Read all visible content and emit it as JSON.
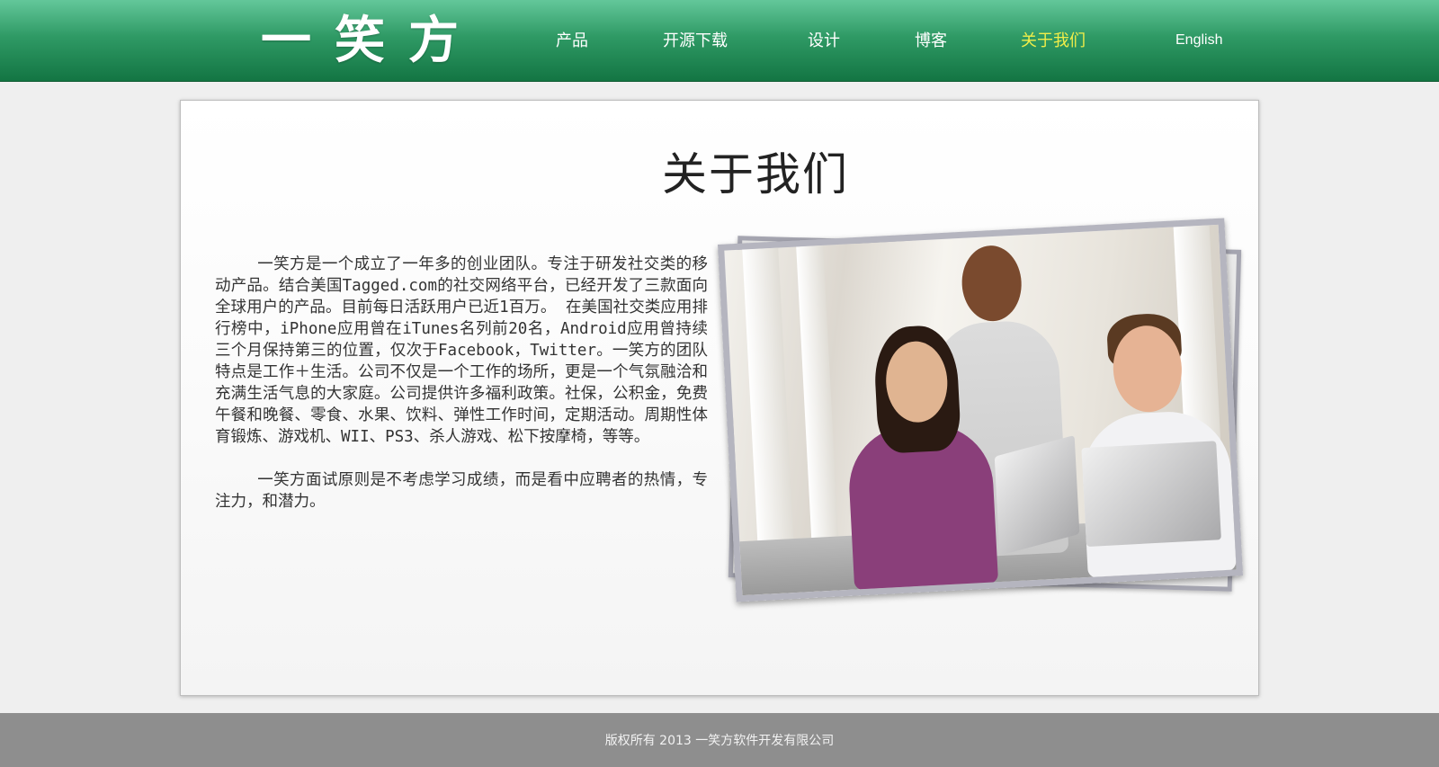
{
  "header": {
    "logo": "一笑方",
    "nav": [
      {
        "label": "产品"
      },
      {
        "label": "开源下载"
      },
      {
        "label": "设计"
      },
      {
        "label": "博客"
      },
      {
        "label": "关于我们",
        "active": true
      }
    ],
    "language": "English",
    "active_color": "#f1ee49"
  },
  "main": {
    "title": "关于我们",
    "paragraphs": [
      "一笑方是一个成立了一年多的创业团队。专注于研发社交类的移动产品。结合美国Tagged.com的社交网络平台，已经开发了三款面向全球用户的产品。目前每日活跃用户已近1百万。   在美国社交类应用排行榜中，iPhone应用曾在iTunes名列前20名，Android应用曾持续三个月保持第三的位置，仅次于Facebook，Twitter。一笑方的团队特点是工作＋生活。公司不仅是一个工作的场所，更是一个气氛融洽和充满生活气息的大家庭。公司提供许多福利政策。社保，公积金，免费午餐和晚餐、零食、水果、饮料、弹性工作时间，定期活动。周期性体育锻炼、游戏机、WII、PS3、杀人游戏、松下按摩椅，等等。",
      "一笑方面试原则是不考虑学习成绩，而是看中应聘者的热情，专注力，和潜力。"
    ]
  },
  "footer": {
    "copyright": "版权所有 2013 一笑方软件开发有限公司"
  }
}
